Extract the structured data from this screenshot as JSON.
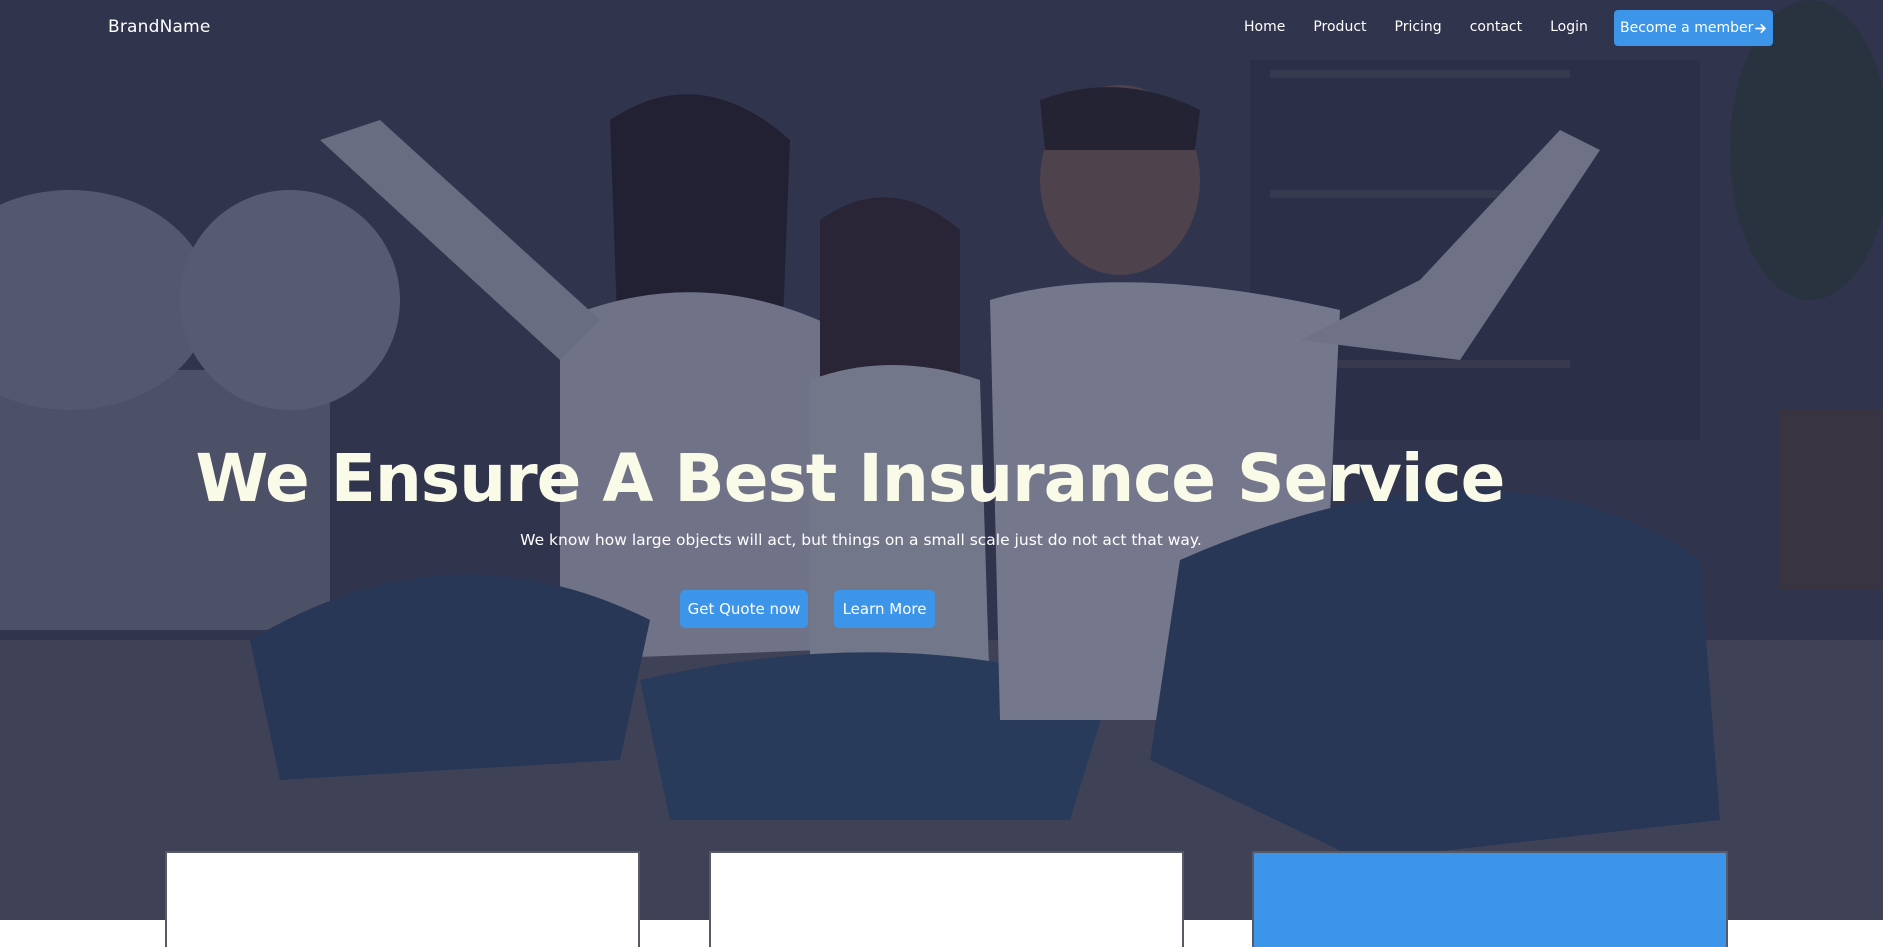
{
  "nav": {
    "brand": "BrandName",
    "links": [
      "Home",
      "Product",
      "Pricing",
      "contact",
      "Login"
    ],
    "cta_label": "Become a member",
    "cta_icon": "arrow-right-icon"
  },
  "hero": {
    "title": "We Ensure A Best Insurance Service",
    "subtitle": "We know how large objects will act, but things on a small scale just do not act that way.",
    "primary_button": "Get Quote now",
    "secondary_button": "Learn More",
    "image": "family-photo"
  },
  "colors": {
    "accent": "#3c95e8",
    "title_text": "#fafae8",
    "overlay": "#1c2042"
  }
}
